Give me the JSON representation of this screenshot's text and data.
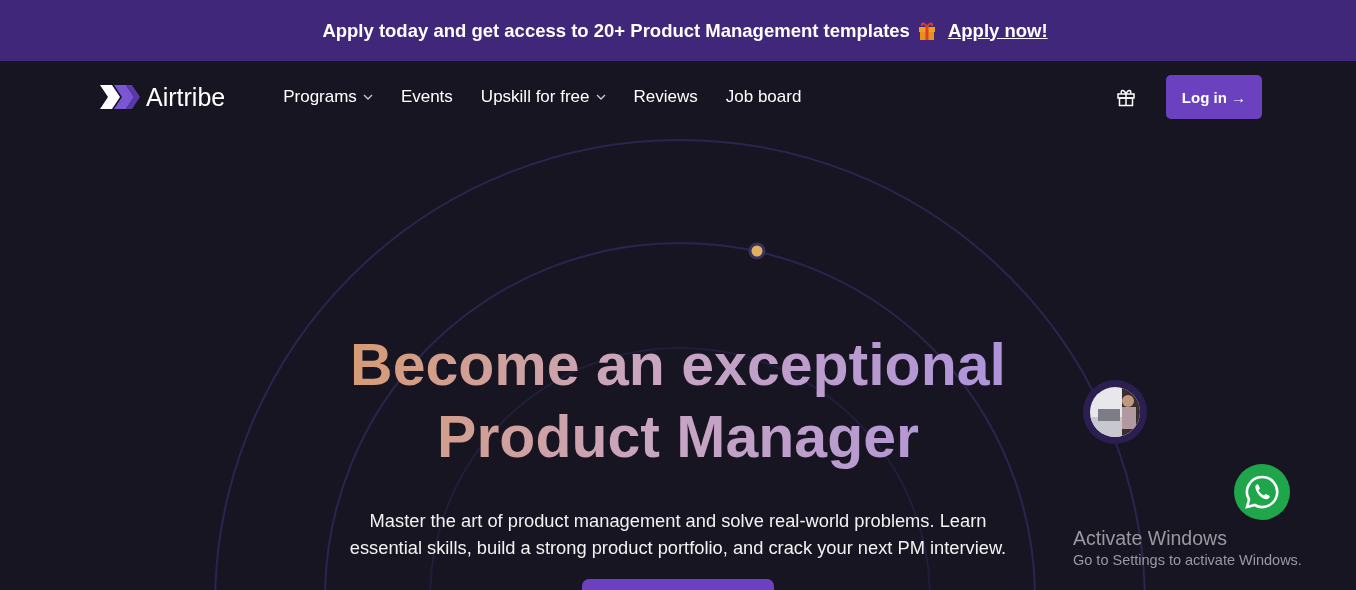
{
  "banner": {
    "text": "Apply today and get access to 20+ Product Management templates",
    "link": "Apply now!"
  },
  "nav": {
    "logo": "Airtribe",
    "items": [
      {
        "label": "Programs",
        "kind": "dropdown"
      },
      {
        "label": "Events",
        "kind": "link"
      },
      {
        "label": "Upskill for free",
        "kind": "dropdown"
      },
      {
        "label": "Reviews",
        "kind": "link"
      },
      {
        "label": "Job board",
        "kind": "link"
      }
    ],
    "login": "Log in →"
  },
  "hero": {
    "title": "Become an exceptional Product Manager",
    "subtitle": "Master the art of product management and solve real-world problems. Learn essential skills, build a strong product portfolio, and crack your next PM interview."
  },
  "os_notice": {
    "title": "Activate Windows",
    "text": "Go to Settings to activate Windows."
  }
}
